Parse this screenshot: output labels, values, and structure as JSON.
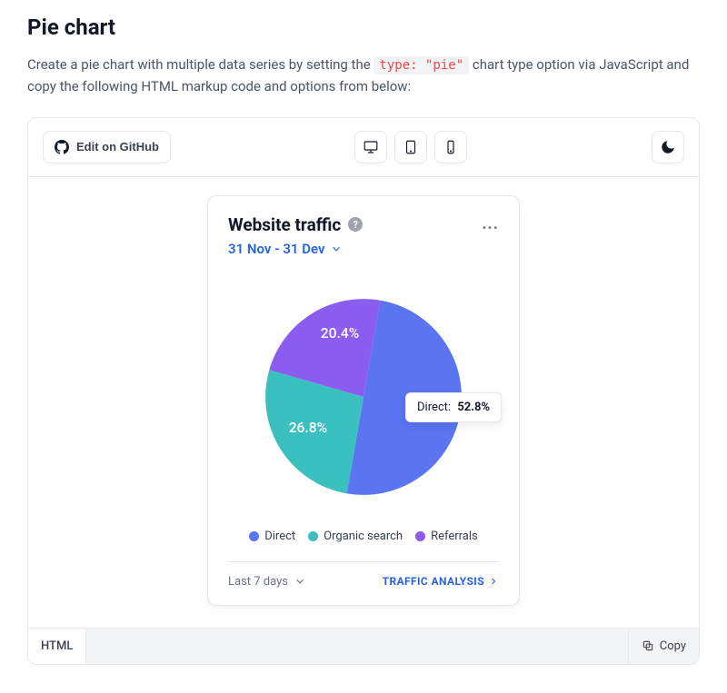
{
  "page": {
    "heading": "Pie chart",
    "intro_before": "Create a pie chart with multiple data series by setting the ",
    "intro_code": "type: \"pie\"",
    "intro_after": " chart type option via JavaScript and copy the following HTML markup code and options from below:"
  },
  "toolbar": {
    "edit_label": "Edit on GitHub"
  },
  "card": {
    "title": "Website traffic",
    "date_range": "31 Nov - 31 Dev",
    "more": "..."
  },
  "tooltip": {
    "label": "Direct:",
    "value": "52.8%"
  },
  "legend": {
    "items": [
      {
        "label": "Direct",
        "color": "#5b74f0"
      },
      {
        "label": "Organic search",
        "color": "#3bc0c0"
      },
      {
        "label": "Referrals",
        "color": "#8a5cf0"
      }
    ]
  },
  "slice_labels": {
    "referrals": "20.4%",
    "organic": "26.8%"
  },
  "footer": {
    "left": "Last 7 days",
    "right": "TRAFFIC ANALYSIS"
  },
  "codebar": {
    "tab": "HTML",
    "copy": "Copy"
  },
  "colors": {
    "direct": "#5b74f0",
    "organic": "#3bc0c0",
    "referrals": "#8a5cf0"
  },
  "chart_data": {
    "type": "pie",
    "title": "Website traffic",
    "categories": [
      "Direct",
      "Organic search",
      "Referrals"
    ],
    "values": [
      52.8,
      26.8,
      20.4
    ],
    "unit": "%"
  }
}
